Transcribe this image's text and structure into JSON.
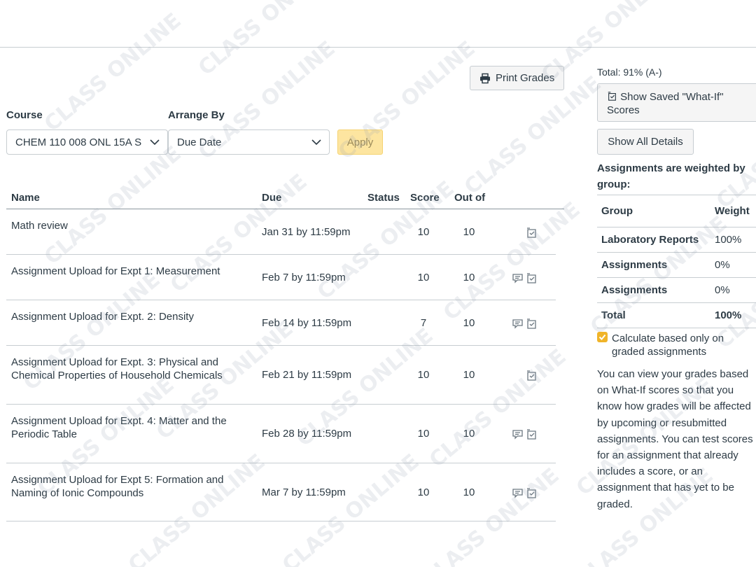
{
  "toolbar": {
    "print_label": "Print Grades"
  },
  "filters": {
    "course_label": "Course",
    "course_value": "CHEM 110 008 ONL 15A S",
    "arrange_label": "Arrange By",
    "arrange_value": "Due Date",
    "apply_label": "Apply"
  },
  "table": {
    "headers": {
      "name": "Name",
      "due": "Due",
      "status": "Status",
      "score": "Score",
      "out_of": "Out of"
    },
    "rows": [
      {
        "name": "Math review",
        "due": "Jan 31 by 11:59pm",
        "score": "10",
        "out_of": "10",
        "icons": [
          "whatif-icon"
        ]
      },
      {
        "name": "Assignment Upload for Expt 1: Measurement",
        "due": "Feb 7 by 11:59pm",
        "score": "10",
        "out_of": "10",
        "icons": [
          "comment-icon",
          "whatif-icon"
        ]
      },
      {
        "name": "Assignment Upload for Expt. 2: Density",
        "due": "Feb 14 by 11:59pm",
        "score": "7",
        "out_of": "10",
        "icons": [
          "comment-icon",
          "whatif-icon"
        ]
      },
      {
        "name": "Assignment Upload for Expt. 3: Physical and Chemical Properties of Household Chemicals",
        "due": "Feb 21 by 11:59pm",
        "score": "10",
        "out_of": "10",
        "icons": [
          "whatif-icon"
        ]
      },
      {
        "name": "Assignment Upload for Expt. 4: Matter and the Periodic Table",
        "due": "Feb 28 by 11:59pm",
        "score": "10",
        "out_of": "10",
        "icons": [
          "comment-icon",
          "whatif-icon"
        ]
      },
      {
        "name": "Assignment Upload for Expt 5: Formation and Naming of Ionic Compounds",
        "due": "Mar 7 by 11:59pm",
        "score": "10",
        "out_of": "10",
        "icons": [
          "comment-icon",
          "whatif-icon"
        ]
      }
    ]
  },
  "sidebar": {
    "total": "Total: 91% (A-)",
    "whatif_label": "Show Saved \"What-If\" Scores",
    "show_all_label": "Show All Details",
    "weighted_note": "Assignments are weighted by group:",
    "weights_header": {
      "group": "Group",
      "weight": "Weight"
    },
    "weights": [
      {
        "group": "Laboratory Reports",
        "weight": "100%"
      },
      {
        "group": "Assignments",
        "weight": "0%"
      },
      {
        "group": "Assignments",
        "weight": "0%"
      }
    ],
    "weights_total": {
      "group": "Total",
      "weight": "100%"
    },
    "calc_label_1": "Calculate based only on",
    "calc_label_2": "graded assignments",
    "calc_checked": true,
    "info": "You can view your grades based on What-If scores so that you know how grades will be affected by upcoming or resubmitted assignments. You can test scores for an assignment that already includes a score, or an assignment that has yet to be graded."
  },
  "watermark": "CLASS ONLINE",
  "colors": {
    "text": "#2d3b45",
    "apply_bg": "#fde5a0",
    "checkbox": "#f0b429",
    "border": "#c7cdd1"
  }
}
